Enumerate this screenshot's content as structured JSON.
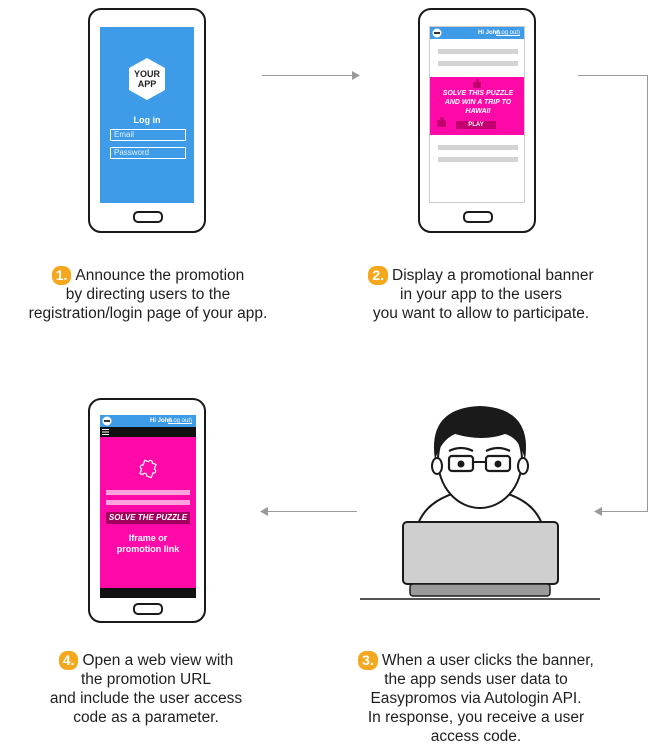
{
  "steps": [
    {
      "number": "1.",
      "lines": [
        "Announce the promotion",
        "by directing users to the",
        "registration/login page of your app."
      ]
    },
    {
      "number": "2.",
      "lines": [
        "Display a promotional banner",
        "in your app to the users",
        "you want to allow to participate."
      ]
    },
    {
      "number": "3.",
      "lines": [
        "When a user clicks the banner,",
        "the app sends user data to",
        "Easypromos via Autologin API.",
        "In response, you receive a user",
        "access code."
      ]
    },
    {
      "number": "4.",
      "lines": [
        "Open a web view with",
        "the promotion URL",
        "and include the user access",
        "code as a parameter."
      ]
    }
  ],
  "phone1": {
    "logo_line1": "YOUR",
    "logo_line2": "APP",
    "login_title": "Log in",
    "email_placeholder": "Email",
    "password_placeholder": "Password"
  },
  "phone2": {
    "greeting": "Hi John",
    "logout": "(Log out)",
    "banner_text": "SOLVE THIS PUZZLE AND WIN A TRIP TO HAWAII",
    "play_label": "PLAY"
  },
  "phone4": {
    "greeting": "Hi John",
    "logout": "(Log out)",
    "solve_label": "SOLVE THE PUZZLE",
    "iframe_line1": "Iframe or",
    "iframe_line2": "promotion link"
  },
  "colors": {
    "blue": "#3d9be8",
    "magenta": "#ff0aa8",
    "orange": "#f5a81e"
  }
}
